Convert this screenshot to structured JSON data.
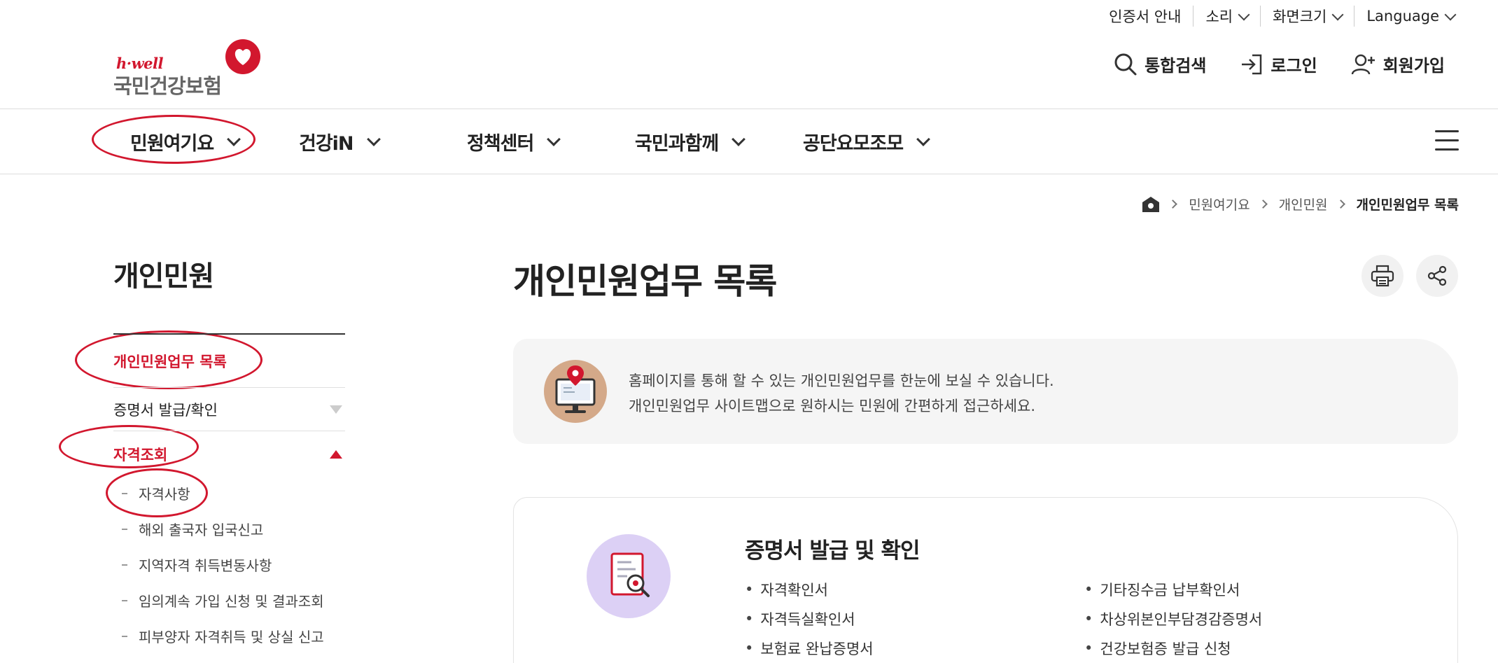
{
  "utility": {
    "cert": "인증서 안내",
    "sound": "소리",
    "screen_size": "화면크기",
    "language": "Language"
  },
  "logo": {
    "brand": "h·well",
    "name": "국민건강보험"
  },
  "account": {
    "search": "통합검색",
    "login": "로그인",
    "signup": "회원가입"
  },
  "gnb": [
    {
      "label": "민원여기요"
    },
    {
      "label": "건강iN"
    },
    {
      "label": "정책센터"
    },
    {
      "label": "국민과함께"
    },
    {
      "label": "공단요모조모"
    }
  ],
  "breadcrumb": {
    "level1": "민원여기요",
    "level2": "개인민원",
    "current": "개인민원업무 목록"
  },
  "sidebar": {
    "title": "개인민원",
    "items": [
      {
        "label": "개인민원업무 목록"
      },
      {
        "label": "증명서 발급/확인"
      },
      {
        "label": "자격조회"
      }
    ],
    "subitems": [
      {
        "label": "자격사항"
      },
      {
        "label": "해외 출국자 입국신고"
      },
      {
        "label": "지역자격 취득변동사항"
      },
      {
        "label": "임의계속 가입 신청 및 결과조회"
      },
      {
        "label": "피부양자 자격취득 및 상실 신고"
      }
    ]
  },
  "main": {
    "title": "개인민원업무 목록",
    "info": {
      "line1": "홈페이지를 통해 할 수 있는 개인민원업무를 한눈에 보실 수 있습니다.",
      "line2": "개인민원업무 사이트맵으로 원하시는 민원에 간편하게 접근하세요."
    },
    "card": {
      "title": "증명서 발급 및 확인",
      "left": [
        "자격확인서",
        "자격득실확인서",
        "보험료 완납증명서"
      ],
      "right": [
        "기타징수금 납부확인서",
        "차상위본인부담경감증명서",
        "건강보험증 발급 신청"
      ]
    }
  },
  "colors": {
    "accent": "#d2172e",
    "info_bg": "#f5f5f5",
    "icon_purple": "#dcd0f5",
    "icon_tan": "#d4a989"
  }
}
